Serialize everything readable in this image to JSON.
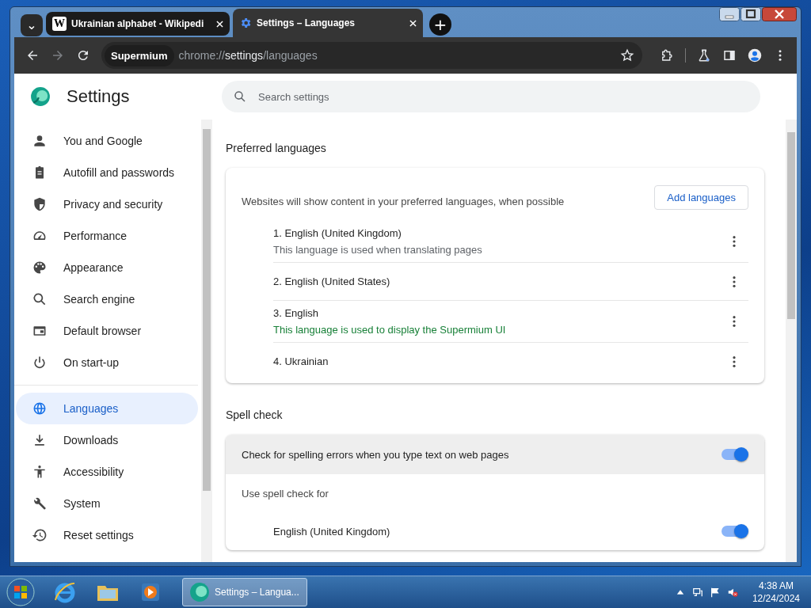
{
  "browser": {
    "tabs": [
      {
        "title": "Ukrainian alphabet - Wikipedi",
        "icon_text": "W",
        "selected": false
      },
      {
        "title": "Settings – Languages",
        "selected": true
      }
    ],
    "tab_search": "⌄",
    "new_tab": "+",
    "profile_chip": "Supermium",
    "url": {
      "scheme": "chrome://",
      "host": "settings",
      "path": "/languages"
    }
  },
  "settings": {
    "title": "Settings",
    "search": {
      "placeholder": "Search settings"
    },
    "sidebar": {
      "items": [
        {
          "label": "You and Google",
          "selected": false
        },
        {
          "label": "Autofill and passwords",
          "selected": false
        },
        {
          "label": "Privacy and security",
          "selected": false
        },
        {
          "label": "Performance",
          "selected": false
        },
        {
          "label": "Appearance",
          "selected": false
        },
        {
          "label": "Search engine",
          "selected": false
        },
        {
          "label": "Default browser",
          "selected": false
        },
        {
          "label": "On start-up",
          "selected": false
        },
        {
          "label": "Languages",
          "selected": true
        },
        {
          "label": "Downloads",
          "selected": false
        },
        {
          "label": "Accessibility",
          "selected": false
        },
        {
          "label": "System",
          "selected": false
        },
        {
          "label": "Reset settings",
          "selected": false
        }
      ]
    },
    "preferred_languages": {
      "heading": "Preferred languages",
      "intro": "Websites will show content in your preferred languages, when possible",
      "add_button": "Add languages",
      "languages": [
        {
          "name": "1. English (United Kingdom)",
          "note": "This language is used when translating pages",
          "highlighted": false
        },
        {
          "name": "2. English (United States)"
        },
        {
          "name": "3. English",
          "note": "This language is used to display the Supermium UI",
          "highlighted": true
        },
        {
          "name": "4. Ukrainian"
        }
      ]
    },
    "spell_check": {
      "heading": "Spell check",
      "rows": [
        {
          "kind": "toggle",
          "label": "Check for spelling errors when you type text on web pages",
          "on": true
        },
        {
          "kind": "label",
          "label": "Use spell check for"
        },
        {
          "kind": "language",
          "label": "English (United Kingdom)",
          "on": true
        }
      ]
    }
  },
  "taskbar": {
    "active_window": "Settings – Langua...",
    "time": "4:38 AM",
    "date": "12/24/2024"
  }
}
